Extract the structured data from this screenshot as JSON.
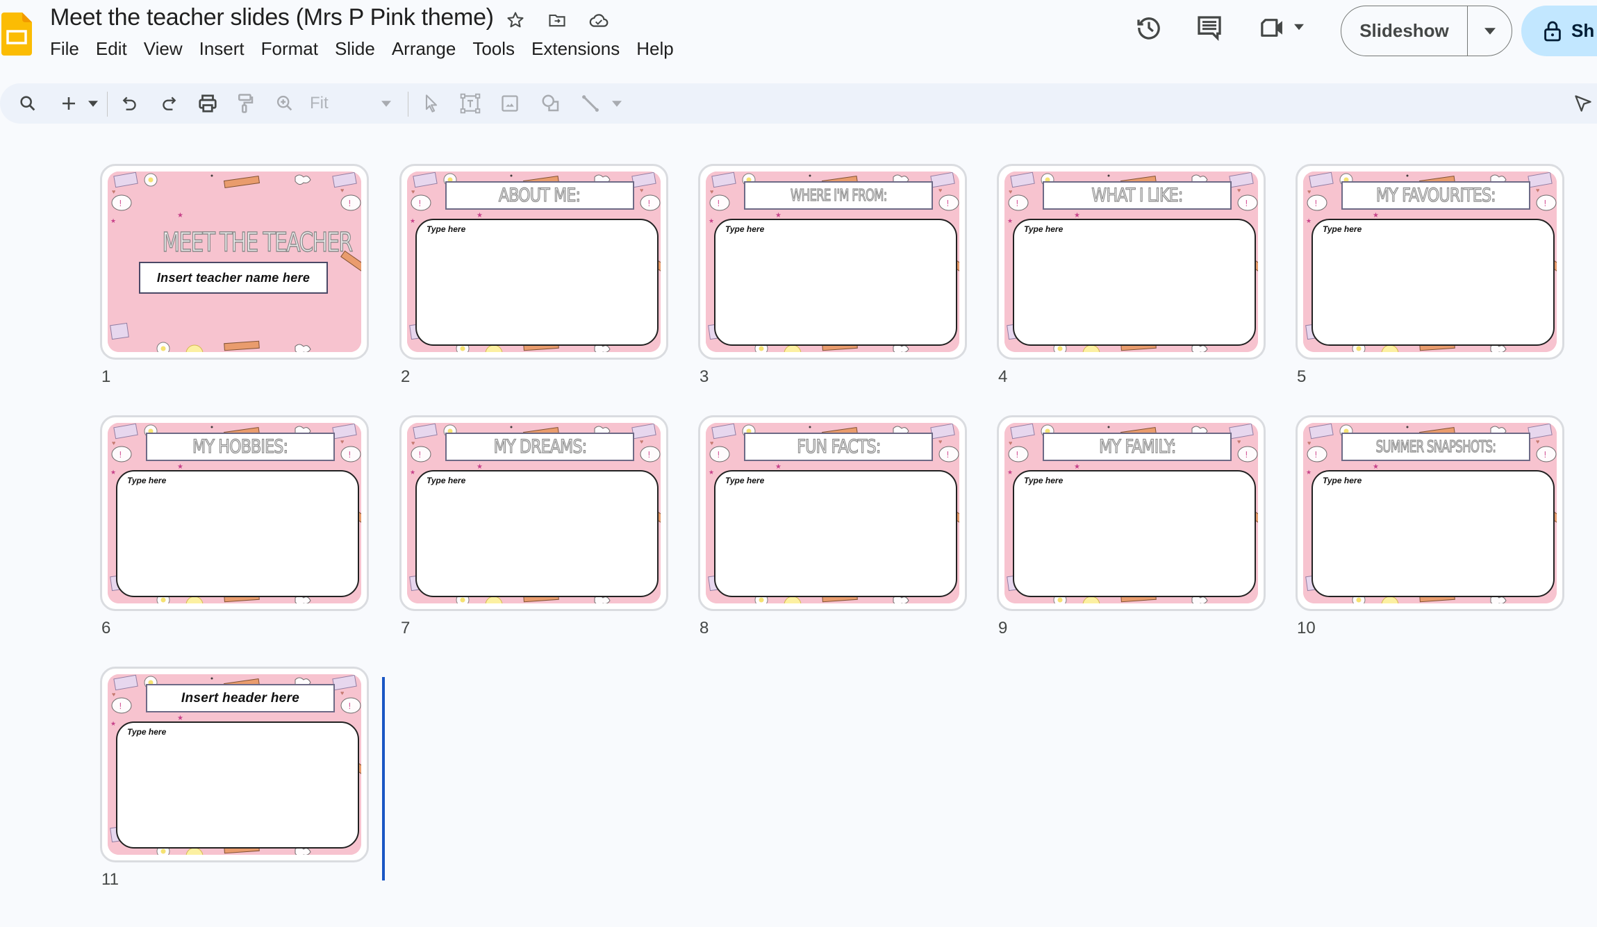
{
  "app": {
    "name": "Google Slides",
    "document_title": "Meet the teacher slides (Mrs P Pink theme)",
    "title_icons": [
      "star-icon",
      "move-to-folder-icon",
      "cloud-saved-icon"
    ],
    "brand_color": "#fbbc04",
    "accent_color": "#c2e7ff"
  },
  "menu": {
    "items": [
      "File",
      "Edit",
      "View",
      "Insert",
      "Format",
      "Slide",
      "Arrange",
      "Tools",
      "Extensions",
      "Help"
    ]
  },
  "actions": {
    "version_history_icon": "history-icon",
    "comments_icon": "comments-icon",
    "meet_icon": "video-camera-icon",
    "slideshow_label": "Slideshow",
    "share_label": "Sh"
  },
  "toolbar": {
    "search": "search-icon",
    "new_slide": "plus-icon",
    "undo": "undo-icon",
    "redo": "redo-icon",
    "print": "print-icon",
    "paint_format": "paint-format-icon",
    "zoom": "zoom-icon",
    "zoom_value": "Fit",
    "select": "cursor-icon",
    "text_box": "text-box-icon",
    "image": "image-icon",
    "shape": "shape-icon",
    "line": "line-icon",
    "edit_mode": "pen-pointer-icon"
  },
  "slides": [
    {
      "number": "1",
      "type": "cover",
      "title": "MEET THE TEACHER",
      "subtitle": "Insert teacher name here"
    },
    {
      "number": "2",
      "type": "content",
      "title": "ABOUT ME:",
      "body": "Type here"
    },
    {
      "number": "3",
      "type": "content",
      "title": "WHERE I'M FROM:",
      "body": "Type here"
    },
    {
      "number": "4",
      "type": "content",
      "title": "WHAT I LIKE:",
      "body": "Type here"
    },
    {
      "number": "5",
      "type": "content",
      "title": "MY FAVOURITES:",
      "body": "Type here"
    },
    {
      "number": "6",
      "type": "content",
      "title": "MY HOBBIES:",
      "body": "Type here"
    },
    {
      "number": "7",
      "type": "content",
      "title": "MY DREAMS:",
      "body": "Type here"
    },
    {
      "number": "8",
      "type": "content",
      "title": "FUN FACTS:",
      "body": "Type here"
    },
    {
      "number": "9",
      "type": "content",
      "title": "MY FAMILY:",
      "body": "Type here"
    },
    {
      "number": "10",
      "type": "content",
      "title": "SUMMER SNAPSHOTS:",
      "body": "Type here"
    },
    {
      "number": "11",
      "type": "header",
      "title": "Insert header here",
      "body": "Type here"
    }
  ]
}
